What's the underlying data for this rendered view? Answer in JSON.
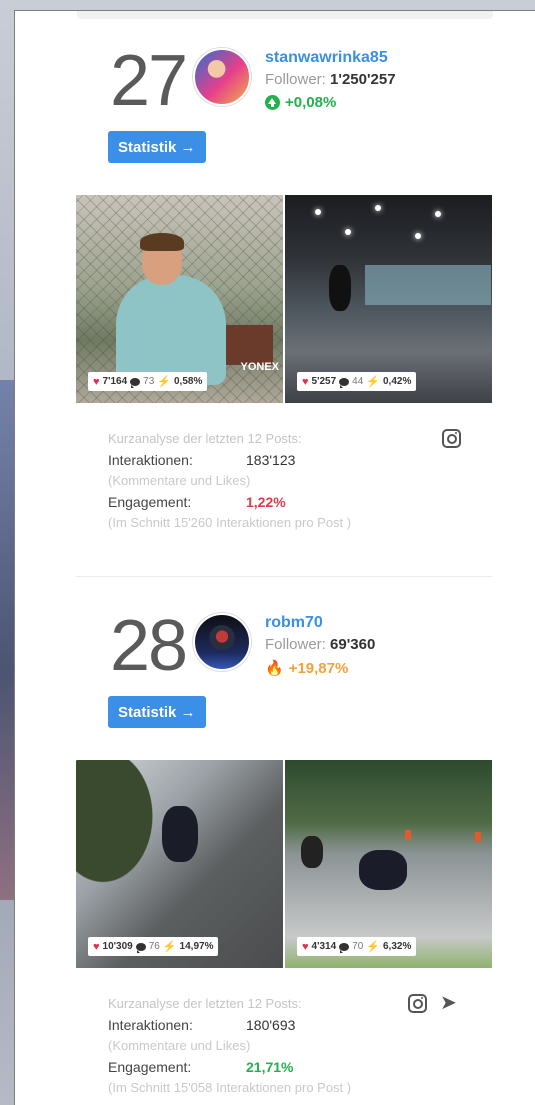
{
  "entries": [
    {
      "rank": "27",
      "username": "stanwawrinka85",
      "followers_label": "Follower:",
      "followers_value": "1'250'257",
      "change": "+0,08%",
      "change_type": "up",
      "stat_button": "Statistik →",
      "posts": [
        {
          "likes": "7'164",
          "comments": "73",
          "engagement": "0,58%"
        },
        {
          "likes": "5'257",
          "comments": "44",
          "engagement": "0,42%"
        }
      ],
      "photo_text": "YONEX",
      "analysis": {
        "title": "Kurzanalyse der letzten 12 Posts:",
        "interactions_label": "Interaktionen:",
        "interactions_value": "183'123",
        "interactions_note": "(Kommentare und Likes)",
        "engagement_label": "Engagement:",
        "engagement_value": "1,22%",
        "engagement_note": "(Im Schnitt 15'260 Interaktionen pro Post )"
      },
      "platform_icons": [
        "instagram-icon"
      ]
    },
    {
      "rank": "28",
      "username": "robm70",
      "followers_label": "Follower:",
      "followers_value": "69'360",
      "change": "+19,87%",
      "change_type": "hot",
      "stat_button": "Statistik →",
      "posts": [
        {
          "likes": "10'309",
          "comments": "76",
          "engagement": "14,97%"
        },
        {
          "likes": "4'314",
          "comments": "70",
          "engagement": "6,32%"
        }
      ],
      "analysis": {
        "title": "Kurzanalyse der letzten 12 Posts:",
        "interactions_label": "Interaktionen:",
        "interactions_value": "180'693",
        "interactions_note": "(Kommentare und Likes)",
        "engagement_label": "Engagement:",
        "engagement_value": "21,71%",
        "engagement_note": "(Im Schnitt 15'058 Interaktionen pro Post )"
      },
      "platform_icons": [
        "instagram-icon",
        "telegram-icon"
      ]
    }
  ],
  "colors": {
    "accent": "#3b8fe6",
    "positive": "#22b14c",
    "negative": "#e03a4a",
    "hot": "#f3a23a"
  }
}
